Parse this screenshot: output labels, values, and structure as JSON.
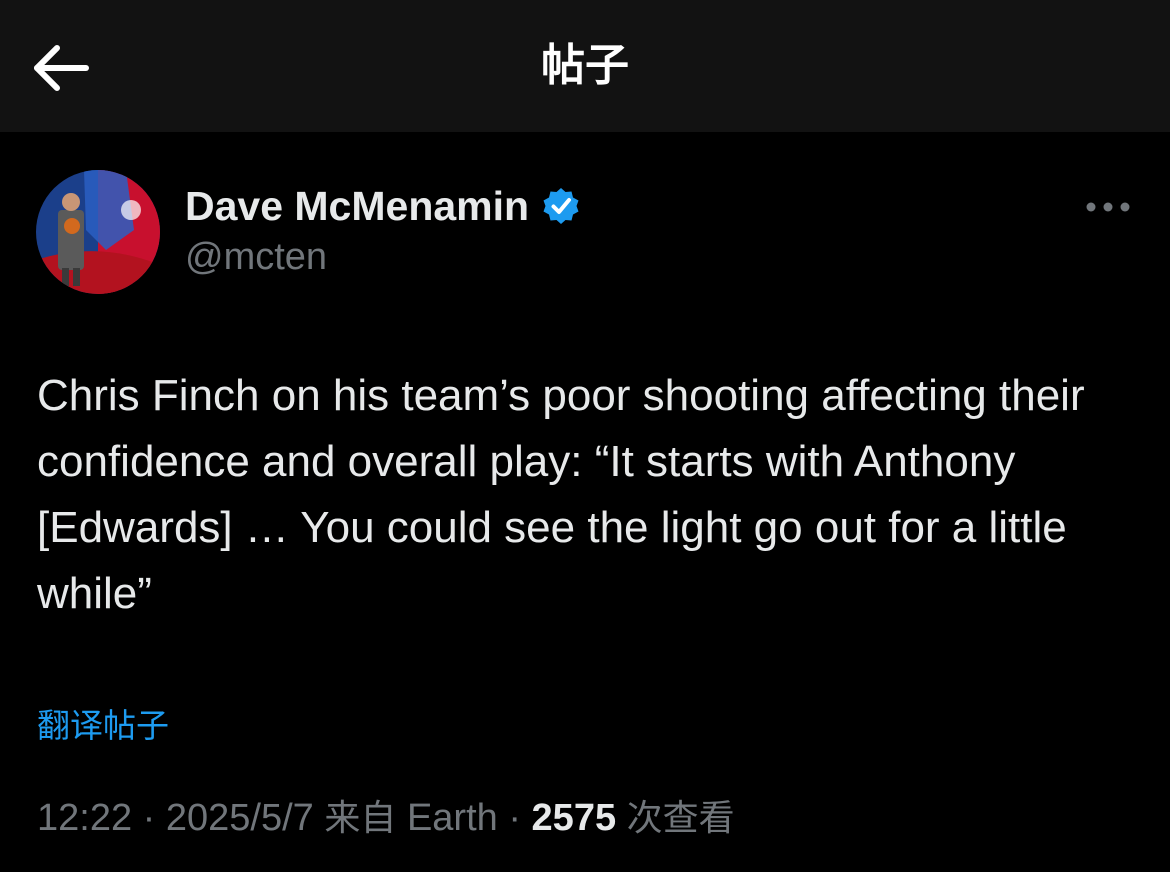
{
  "header": {
    "title": "帖子"
  },
  "author": {
    "display_name": "Dave McMenamin",
    "handle": "@mcten",
    "verified": true
  },
  "tweet": {
    "text": "Chris Finch on his team’s poor shooting affecting their confidence and overall play: “It starts with Anthony [Edwards] … You could see the light go out for a little while”",
    "translate_label": "翻译帖子"
  },
  "meta": {
    "time": "12:22",
    "separator": " · ",
    "date": "2025/5/7",
    "source_prefix": "来自",
    "source": "Earth",
    "views_count": "2575",
    "views_label": "次查看"
  },
  "colors": {
    "background": "#000000",
    "header_background": "#121212",
    "link": "#1d9bf0",
    "secondary_text": "#71767b",
    "primary_text": "#e7e9ea"
  },
  "icons": {
    "back": "arrow-left-icon",
    "verified": "verified-badge-icon",
    "more": "more-horizontal-icon"
  }
}
